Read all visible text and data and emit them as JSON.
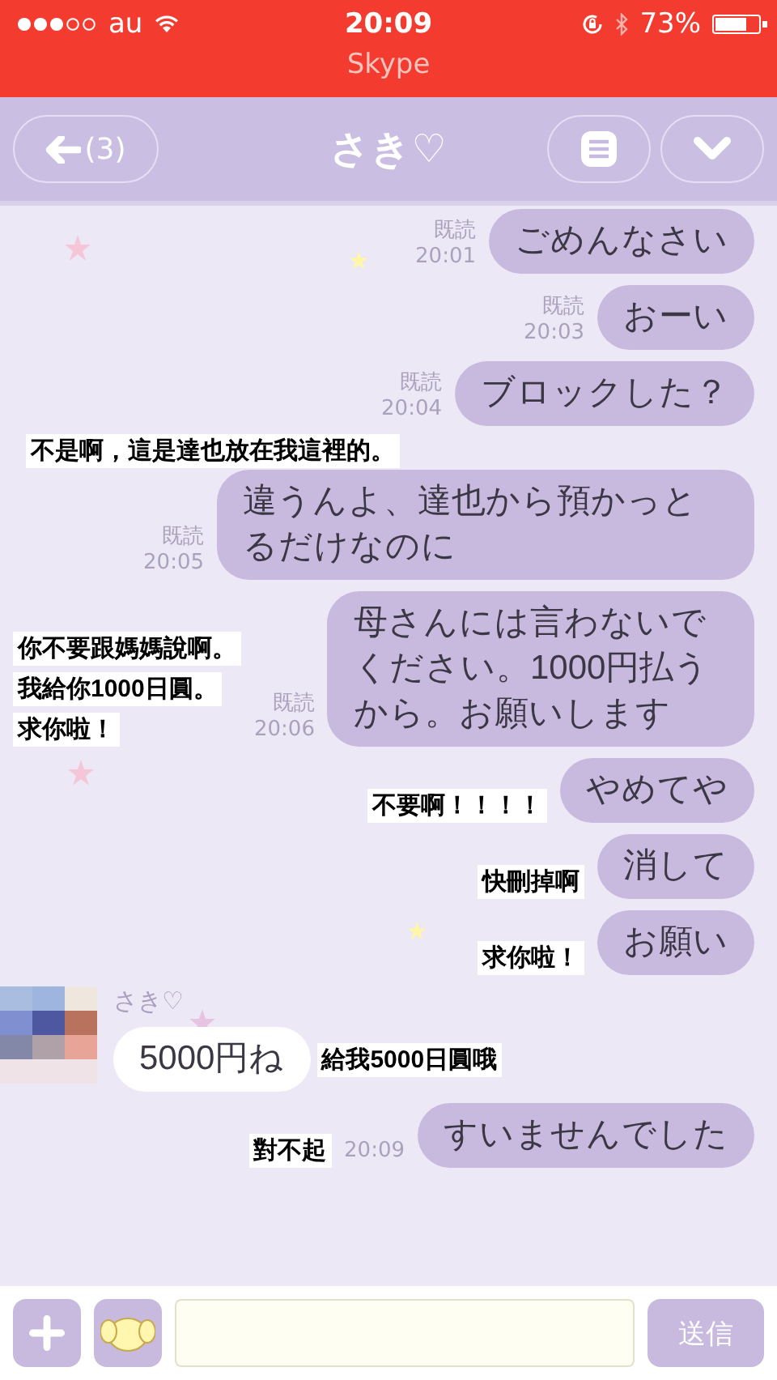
{
  "status_bar": {
    "carrier": "au",
    "time": "20:09",
    "battery_percent": "73%",
    "battery": {
      "level": 0.73
    }
  },
  "call_bar": {
    "label": "Skype"
  },
  "nav": {
    "back_count": "(3)",
    "title": "さき♡"
  },
  "messages": [
    {
      "kind": "sent",
      "text": "ごめんなさい",
      "read": "既読",
      "time": "20:01"
    },
    {
      "kind": "sent",
      "text": "おーい",
      "read": "既読",
      "time": "20:03"
    },
    {
      "kind": "sent",
      "text": "ブロックした？",
      "read": "既読",
      "time": "20:04"
    },
    {
      "kind": "caption",
      "text": "不是啊，這是達也放在我這裡的。"
    },
    {
      "kind": "sent",
      "text": "違うんよ、達也から預かっとるだけなのに",
      "read": "既読",
      "time": "20:05"
    },
    {
      "kind": "sent",
      "text": "母さんには言わないでください。1000円払うから。お願いします",
      "read": "既読",
      "time": "20:06",
      "caption": [
        "你不要跟媽媽說啊。",
        "我給你1000日圓。",
        "求你啦！"
      ]
    },
    {
      "kind": "sent",
      "text": "やめてや",
      "caption": [
        "不要啊！！！！"
      ]
    },
    {
      "kind": "sent",
      "text": "消して",
      "caption": [
        "快刪掉啊"
      ]
    },
    {
      "kind": "sent",
      "text": "お願い",
      "caption": [
        "求你啦！"
      ]
    },
    {
      "kind": "received",
      "sender": "さき♡",
      "text": "5000円ね",
      "caption": [
        "給我5000日圓哦"
      ]
    },
    {
      "kind": "sent",
      "text": "すいませんでした",
      "time": "20:09",
      "caption": [
        "對不起"
      ]
    }
  ],
  "composer": {
    "send_label": "送信"
  }
}
